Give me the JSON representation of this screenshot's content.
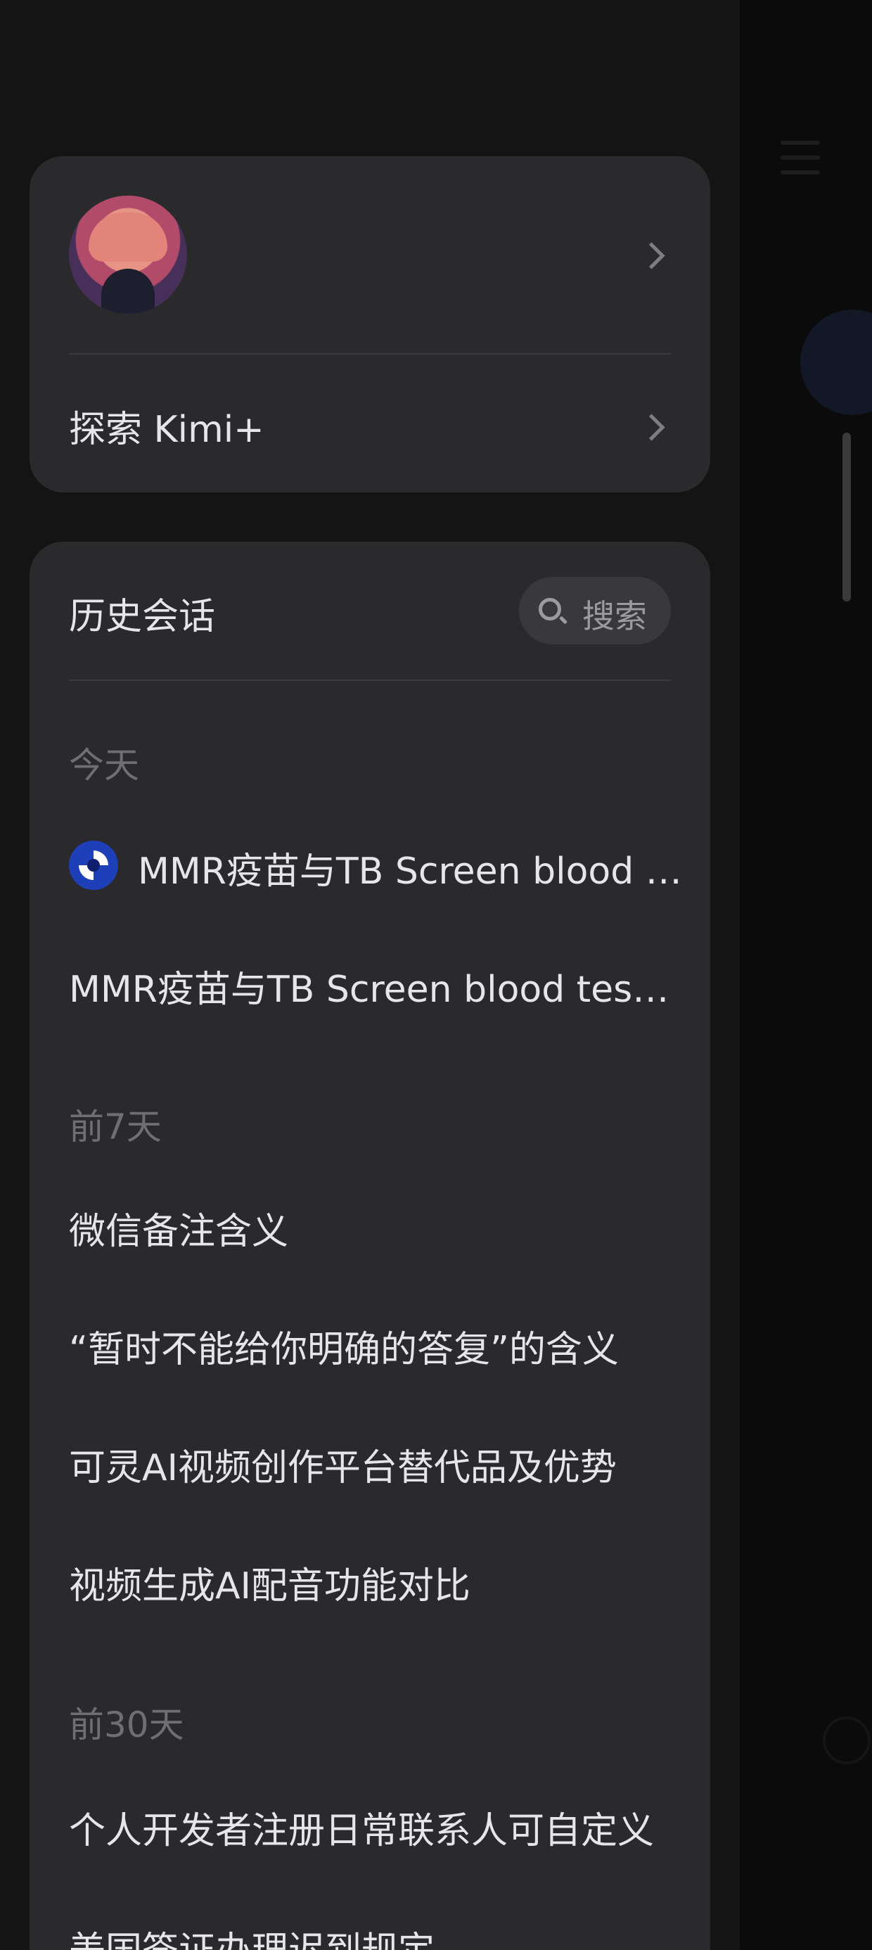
{
  "profile": {
    "explore_label": "探索 Kimi+"
  },
  "history": {
    "title": "历史会话",
    "search_label": "搜索",
    "groups": [
      {
        "label": "今天",
        "items": [
          "MMR疫苗与TB Screen blood test区别",
          "MMR疫苗与TB Screen blood test区别"
        ]
      },
      {
        "label": "前7天",
        "items": [
          "微信备注含义",
          "“暂时不能给你明确的答复”的含义",
          "可灵AI视频创作平台替代品及优势",
          "视频生成AI配音功能对比"
        ]
      },
      {
        "label": "前30天",
        "items": [
          "个人开发者注册日常联系人可自定义",
          "美国签证办理迟到规定"
        ]
      }
    ]
  }
}
